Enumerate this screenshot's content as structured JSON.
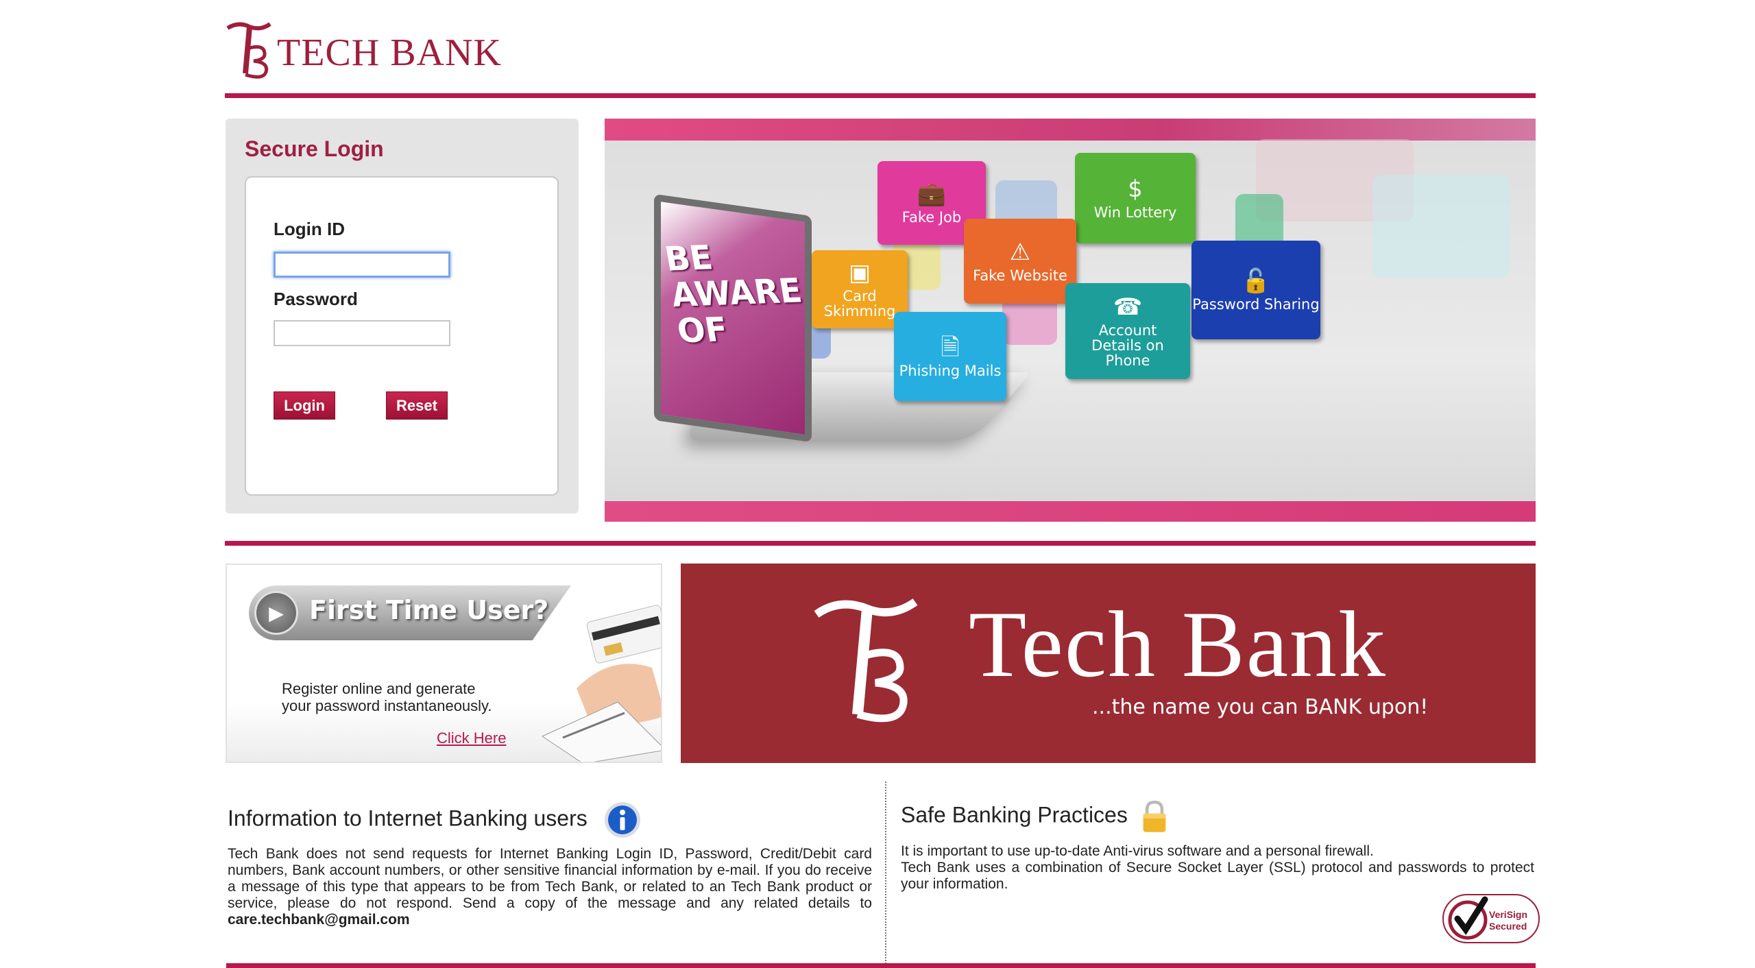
{
  "header": {
    "logo_text": "TECH BANK"
  },
  "login": {
    "title": "Secure Login",
    "login_id_label": "Login ID",
    "login_id_value": "",
    "password_label": "Password",
    "password_value": "",
    "login_button": "Login",
    "reset_button": "Reset"
  },
  "banner": {
    "laptop_text": "BE AWARE OF",
    "tiles": [
      {
        "label": "Fake Job",
        "icon": "briefcase-icon",
        "color": "#e03a9c"
      },
      {
        "label": "Win Lottery",
        "icon": "money-bag-icon",
        "color": "#55b337"
      },
      {
        "label": "Fake Website",
        "icon": "warning-icon",
        "color": "#e8692b"
      },
      {
        "label": "Card Skimming",
        "icon": "card-icon",
        "color": "#f0a41f"
      },
      {
        "label": "Phishing Mails",
        "icon": "document-icon",
        "color": "#27aee0"
      },
      {
        "label": "Account Details on Phone",
        "icon": "phone-person-icon",
        "color": "#1e9e9a"
      },
      {
        "label": "Password Sharing",
        "icon": "padlock-open-icon",
        "color": "#1c3fb0"
      }
    ]
  },
  "first_time": {
    "title": "First Time User?",
    "description": "Register online and generate your password instantaneously.",
    "link": "Click Here"
  },
  "brand_banner": {
    "name": "Tech Bank",
    "tagline": "...the name you can BANK upon!"
  },
  "info": {
    "title": "Information to Internet Banking users",
    "text": "Tech Bank does not send requests for Internet Banking Login ID, Password, Credit/Debit card numbers, Bank account numbers, or other sensitive financial information by e-mail. If you do receive a message of this type that appears to be from Tech Bank, or related to an Tech Bank product or service, please do not respond. Send a copy of the message and any related details to",
    "email": "care.techbank@gmail.com"
  },
  "safe": {
    "title": "Safe Banking Practices",
    "line1": "It is important to use up-to-date Anti-virus software and a personal firewall.",
    "line2": "Tech Bank uses a combination of Secure Socket Layer (SSL) protocol and passwords to protect your information.",
    "badge_line1": "VeriSign",
    "badge_line2": "Secured"
  },
  "colors": {
    "brand": "#b8184b",
    "brand_dark": "#9a2b33",
    "link": "#b8184b"
  }
}
